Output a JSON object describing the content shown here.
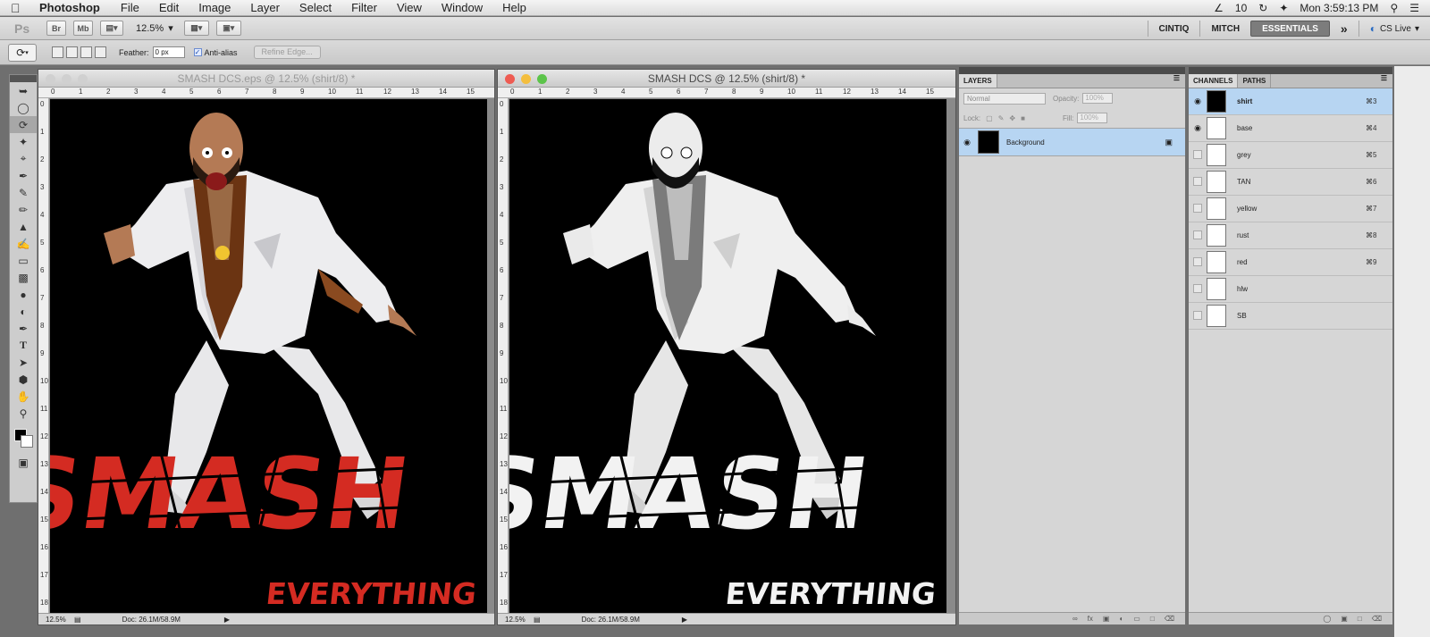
{
  "menubar": {
    "app": "Photoshop",
    "items": [
      "File",
      "Edit",
      "Image",
      "Layer",
      "Select",
      "Filter",
      "View",
      "Window",
      "Help"
    ],
    "status": {
      "adobe": "10",
      "datetime": "Mon 3:59:13 PM"
    }
  },
  "appbar": {
    "logo": "Ps",
    "bridge": "Br",
    "minibridge": "Mb",
    "zoom": "12.5%",
    "workspaces": [
      "CINTIQ",
      "MITCH",
      "ESSENTIALS"
    ],
    "more": "»",
    "cslive": "CS Live"
  },
  "options": {
    "feather_label": "Feather:",
    "feather_value": "0 px",
    "antialias_label": "Anti-alias",
    "refine_edge": "Refine Edge..."
  },
  "doc1": {
    "title": "SMASH DCS.eps @ 12.5% (shirt/8) *",
    "zoom": "12.5%",
    "docinfo": "Doc: 26.1M/58.9M",
    "ruler_h": [
      "0",
      "1",
      "2",
      "3",
      "4",
      "5",
      "6",
      "7",
      "8",
      "9",
      "10",
      "11",
      "12",
      "13",
      "14",
      "15"
    ],
    "ruler_v": [
      "0",
      "1",
      "2",
      "3",
      "4",
      "5",
      "6",
      "7",
      "8",
      "9",
      "10",
      "11",
      "12",
      "13",
      "14",
      "15",
      "16",
      "17",
      "18"
    ]
  },
  "doc2": {
    "title": "SMASH DCS @ 12.5% (shirt/8) *",
    "zoom": "12.5%",
    "docinfo": "Doc: 26.1M/58.9M",
    "ruler_h": [
      "0",
      "1",
      "2",
      "3",
      "4",
      "5",
      "6",
      "7",
      "8",
      "9",
      "10",
      "11",
      "12",
      "13",
      "14",
      "15"
    ],
    "ruler_v": [
      "0",
      "1",
      "2",
      "3",
      "4",
      "5",
      "6",
      "7",
      "8",
      "9",
      "10",
      "11",
      "12",
      "13",
      "14",
      "15",
      "16",
      "17",
      "18"
    ]
  },
  "artwork": {
    "title": "SMASH",
    "subtitle": "EVERYTHING",
    "title_color_left": "#d42b22",
    "title_color_right": "#f2f2f2"
  },
  "layers": {
    "tab": "LAYERS",
    "blend": "Normal",
    "opacity_label": "Opacity:",
    "opacity_value": "100%",
    "lock_label": "Lock:",
    "fill_label": "Fill:",
    "fill_value": "100%",
    "rows": [
      {
        "name": "Background"
      }
    ]
  },
  "channels": {
    "tabs": [
      "CHANNELS",
      "PATHS"
    ],
    "rows": [
      {
        "name": "shirt",
        "shortcut": "⌘3"
      },
      {
        "name": "base",
        "shortcut": "⌘4"
      },
      {
        "name": "grey",
        "shortcut": "⌘5"
      },
      {
        "name": "TAN",
        "shortcut": "⌘6"
      },
      {
        "name": "yellow",
        "shortcut": "⌘7"
      },
      {
        "name": "rust",
        "shortcut": "⌘8"
      },
      {
        "name": "red",
        "shortcut": "⌘9"
      },
      {
        "name": "hlw",
        "shortcut": ""
      },
      {
        "name": "SB",
        "shortcut": ""
      }
    ]
  }
}
